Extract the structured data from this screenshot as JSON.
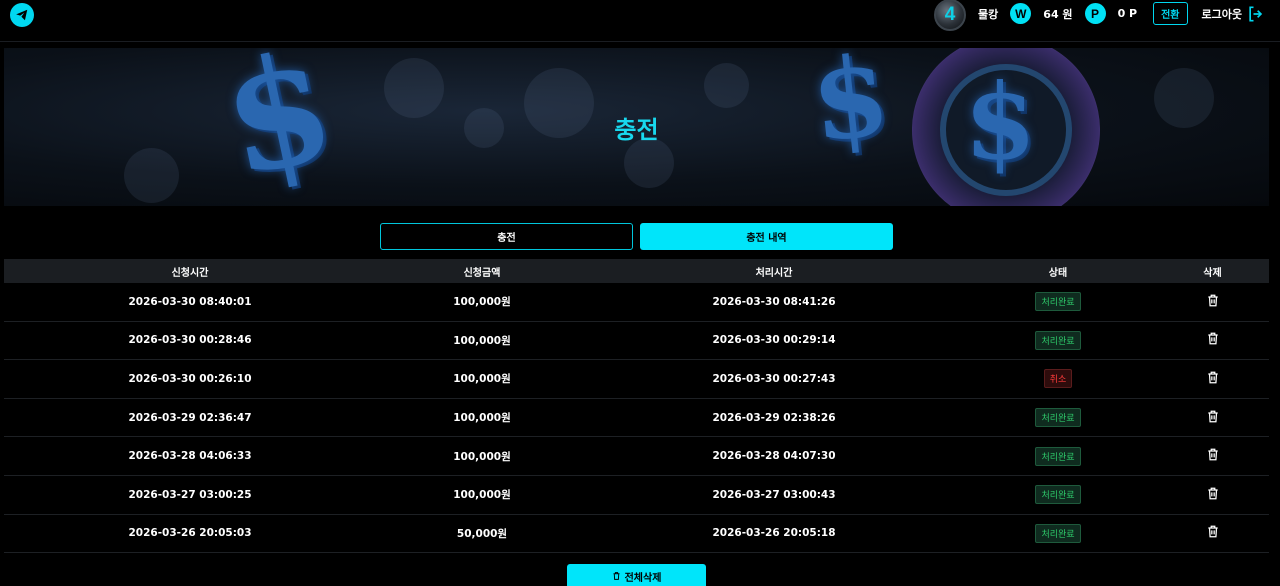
{
  "header": {
    "level": "4",
    "username": "물캉",
    "won_symbol": "W",
    "balance": "64 원",
    "point_symbol": "P",
    "points": "0 P",
    "switch_label": "전환",
    "logout_label": "로그아웃"
  },
  "banner": {
    "title": "충전"
  },
  "tabs": [
    {
      "label": "충전",
      "active": false
    },
    {
      "label": "충전 내역",
      "active": true
    }
  ],
  "table": {
    "columns": [
      "신청시간",
      "신청금액",
      "처리시간",
      "상태",
      "삭제"
    ],
    "rows": [
      {
        "requested": "2026-03-30 08:40:01",
        "amount": "100,000원",
        "processed": "2026-03-30 08:41:26",
        "status": "처리완료"
      },
      {
        "requested": "2026-03-30 00:28:46",
        "amount": "100,000원",
        "processed": "2026-03-30 00:29:14",
        "status": "처리완료"
      },
      {
        "requested": "2026-03-30 00:26:10",
        "amount": "100,000원",
        "processed": "2026-03-30 00:27:43",
        "status": "취소"
      },
      {
        "requested": "2026-03-29 02:36:47",
        "amount": "100,000원",
        "processed": "2026-03-29 02:38:26",
        "status": "처리완료"
      },
      {
        "requested": "2026-03-28 04:06:33",
        "amount": "100,000원",
        "processed": "2026-03-28 04:07:30",
        "status": "처리완료"
      },
      {
        "requested": "2026-03-27 03:00:25",
        "amount": "100,000원",
        "processed": "2026-03-27 03:00:43",
        "status": "처리완료"
      },
      {
        "requested": "2026-03-26 20:05:03",
        "amount": "50,000원",
        "processed": "2026-03-26 20:05:18",
        "status": "처리완료"
      }
    ]
  },
  "delete_all_label": "전체삭제",
  "colors": {
    "accent": "#00e5fa",
    "done": "#2ec96a",
    "cancel": "#ff3b3b"
  }
}
